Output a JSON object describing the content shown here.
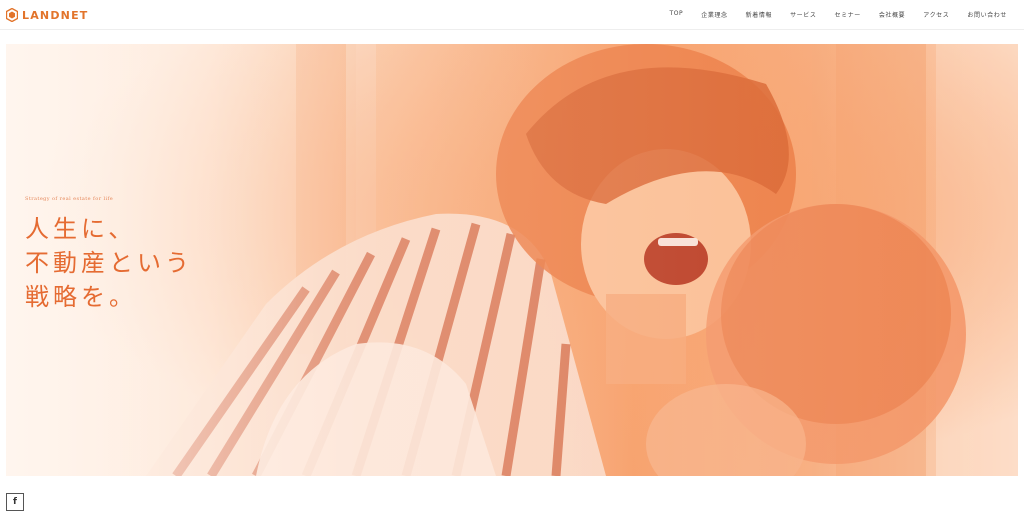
{
  "brand": {
    "name": "LANDNET",
    "accent": "#e2742b"
  },
  "nav": {
    "items": [
      {
        "label": "TOP"
      },
      {
        "label": "企業理念"
      },
      {
        "label": "新着情報"
      },
      {
        "label": "サービス"
      },
      {
        "label": "セミナー"
      },
      {
        "label": "会社概要"
      },
      {
        "label": "アクセス"
      },
      {
        "label": "お問い合わせ"
      }
    ]
  },
  "hero": {
    "subtitle": "Strategy of real estate for life",
    "headline_lines": [
      "人生に、",
      "不動産という",
      "戦略を。"
    ],
    "text_color": "#e56b32"
  },
  "social": {
    "facebook_icon": "facebook-icon",
    "facebook_label": "f"
  }
}
